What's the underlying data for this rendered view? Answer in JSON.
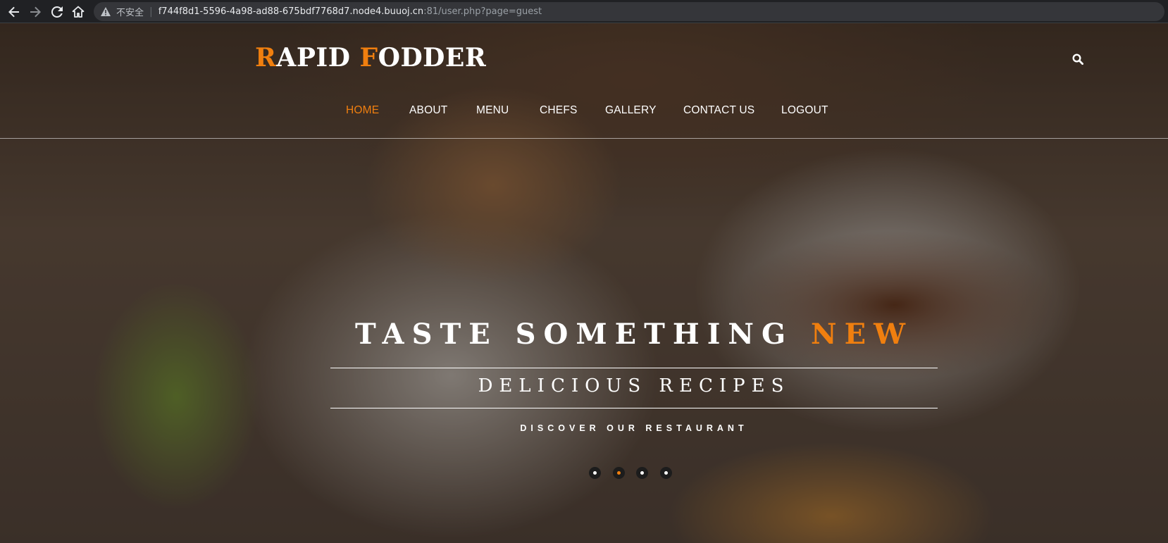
{
  "browser": {
    "back_icon": "arrow-left-icon",
    "forward_icon": "arrow-right-icon",
    "reload_icon": "reload-icon",
    "home_icon": "home-icon",
    "security_label": "不安全",
    "url_host": "f744f8d1-5596-4a98-ad88-675bdf7768d7.node4.buuoj.cn",
    "url_path": ":81/user.php?page=guest"
  },
  "header": {
    "logo_first_initial": "R",
    "logo_first_rest": "APID ",
    "logo_second_initial": "F",
    "logo_second_rest": "ODDER",
    "search_icon": "search-icon"
  },
  "nav": {
    "items": [
      {
        "label": "HOME",
        "active": true
      },
      {
        "label": "ABOUT",
        "active": false
      },
      {
        "label": "MENU",
        "active": false
      },
      {
        "label": "CHEFS",
        "active": false
      },
      {
        "label": "GALLERY",
        "active": false
      },
      {
        "label": "CONTACT US",
        "active": false
      },
      {
        "label": "LOGOUT",
        "active": false
      }
    ]
  },
  "hero": {
    "title_main": "TASTE SOMETHING ",
    "title_accent": "NEW",
    "subtitle": "DELICIOUS RECIPES",
    "cta": "DISCOVER OUR RESTAURANT",
    "slides_total": 4,
    "active_slide": 2
  },
  "colors": {
    "accent": "#f07f0f",
    "text": "#ffffff",
    "chrome_bg": "#202124"
  }
}
